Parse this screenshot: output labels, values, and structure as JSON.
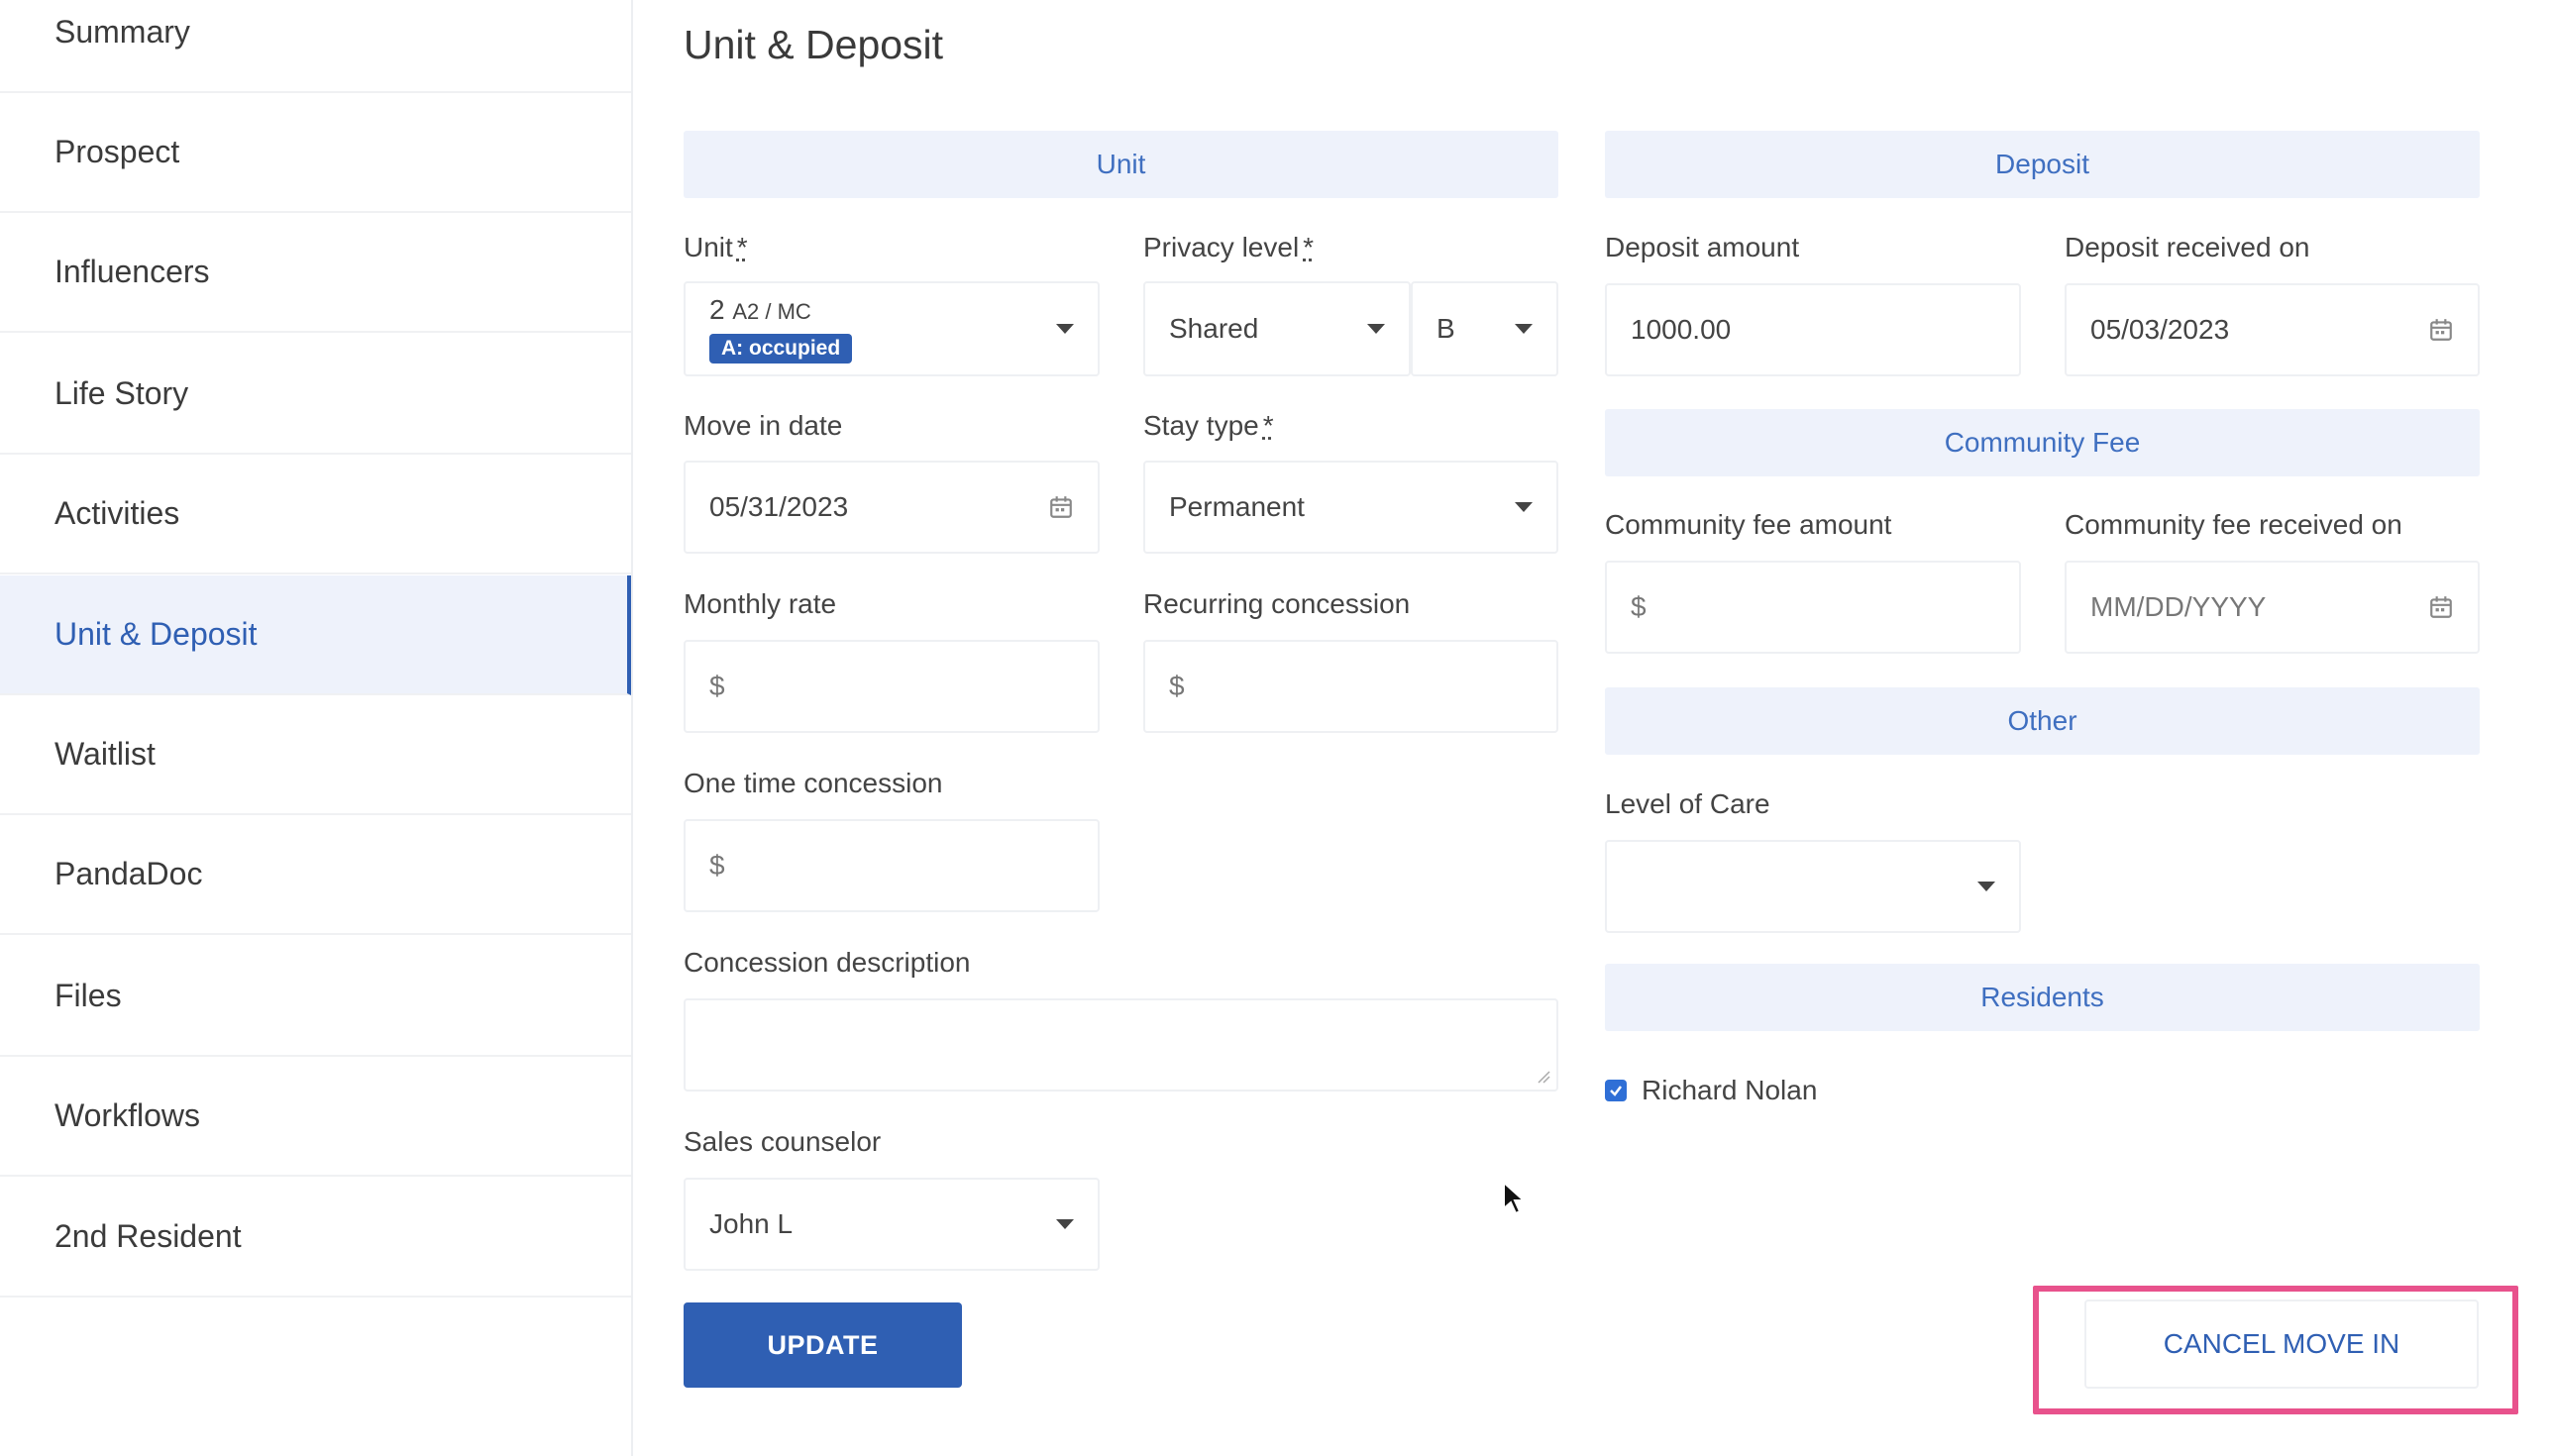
{
  "sidebar": {
    "items": [
      {
        "label": "Summary"
      },
      {
        "label": "Prospect"
      },
      {
        "label": "Influencers"
      },
      {
        "label": "Life Story"
      },
      {
        "label": "Activities"
      },
      {
        "label": "Unit & Deposit",
        "active": true
      },
      {
        "label": "Waitlist"
      },
      {
        "label": "PandaDoc"
      },
      {
        "label": "Files"
      },
      {
        "label": "Workflows"
      },
      {
        "label": "2nd Resident"
      }
    ]
  },
  "page": {
    "title": "Unit & Deposit"
  },
  "unit_section": {
    "heading": "Unit",
    "unit": {
      "label": "Unit",
      "required_mark": "*",
      "value_main": "2",
      "value_sub": "A2 / MC",
      "badge": "A: occupied"
    },
    "privacy_level": {
      "label": "Privacy level",
      "required_mark": "*",
      "value": "Shared",
      "bed_value": "B"
    },
    "move_in_date": {
      "label": "Move in date",
      "value": "05/31/2023"
    },
    "stay_type": {
      "label": "Stay type",
      "required_mark": "*",
      "value": "Permanent"
    },
    "monthly_rate": {
      "label": "Monthly rate",
      "placeholder": "$"
    },
    "recurring_concession": {
      "label": "Recurring concession",
      "placeholder": "$"
    },
    "one_time_concession": {
      "label": "One time concession",
      "placeholder": "$"
    },
    "concession_description": {
      "label": "Concession description",
      "value": ""
    },
    "sales_counselor": {
      "label": "Sales counselor",
      "value": "John L"
    }
  },
  "deposit_section": {
    "heading": "Deposit",
    "deposit_amount": {
      "label": "Deposit amount",
      "value": "1000.00"
    },
    "deposit_received_on": {
      "label": "Deposit received on",
      "value": "05/03/2023"
    }
  },
  "community_fee_section": {
    "heading": "Community Fee",
    "amount": {
      "label": "Community fee amount",
      "placeholder": "$"
    },
    "received_on": {
      "label": "Community fee received on",
      "placeholder": "MM/DD/YYYY"
    }
  },
  "other_section": {
    "heading": "Other",
    "level_of_care": {
      "label": "Level of Care",
      "value": ""
    }
  },
  "residents_section": {
    "heading": "Residents",
    "residents": [
      {
        "name": "Richard Nolan",
        "checked": true
      }
    ]
  },
  "actions": {
    "update_label": "UPDATE",
    "cancel_move_in_label": "CANCEL MOVE IN"
  },
  "colors": {
    "accent": "#2f5fb3",
    "section_band": "#eef2fb",
    "highlight": "#e8528c"
  }
}
